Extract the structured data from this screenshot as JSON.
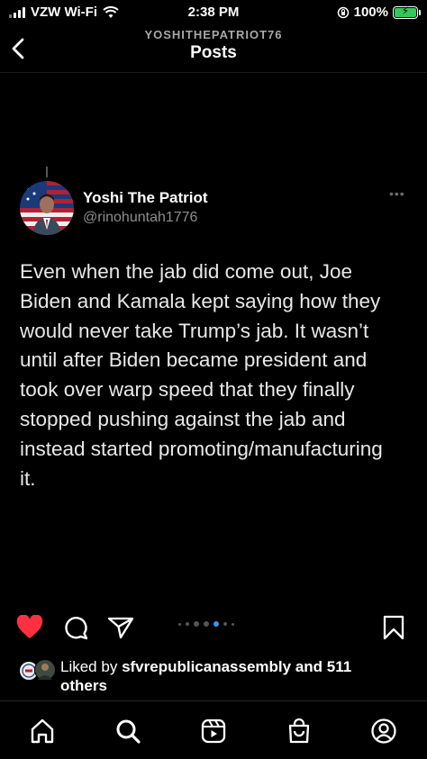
{
  "status_bar": {
    "carrier": "VZW Wi-Fi",
    "time": "2:38 PM",
    "battery_percent": "100%",
    "battery_level": 1.0,
    "charging": true
  },
  "header": {
    "username": "YOSHITHEPATRIOT76",
    "title": "Posts"
  },
  "tweet": {
    "display_name": "Yoshi The Patriot",
    "handle": "@rinohuntah1776",
    "text": "Even when the jab did come out, Joe Biden and Kamala kept saying how they would never take Trump’s jab. It wasn’t until after Biden became president and took over warp speed that they finally stopped pushing against the jab and instead started promoting/manufacturing it."
  },
  "actions": {
    "liked": true,
    "carousel_total": 7,
    "carousel_active": 5
  },
  "likes": {
    "prefix": "Liked by",
    "user": "sfvrepublicanassembly",
    "suffix": "and 511 others"
  },
  "colors": {
    "background": "#000000",
    "heart": "#ff3040",
    "active_dot": "#3897f0",
    "battery": "#34c759"
  },
  "icons": [
    "back-arrow-icon",
    "home-icon",
    "search-icon",
    "reels-icon",
    "shop-icon",
    "profile-icon",
    "heart-icon",
    "comment-icon",
    "share-icon",
    "bookmark-icon"
  ]
}
